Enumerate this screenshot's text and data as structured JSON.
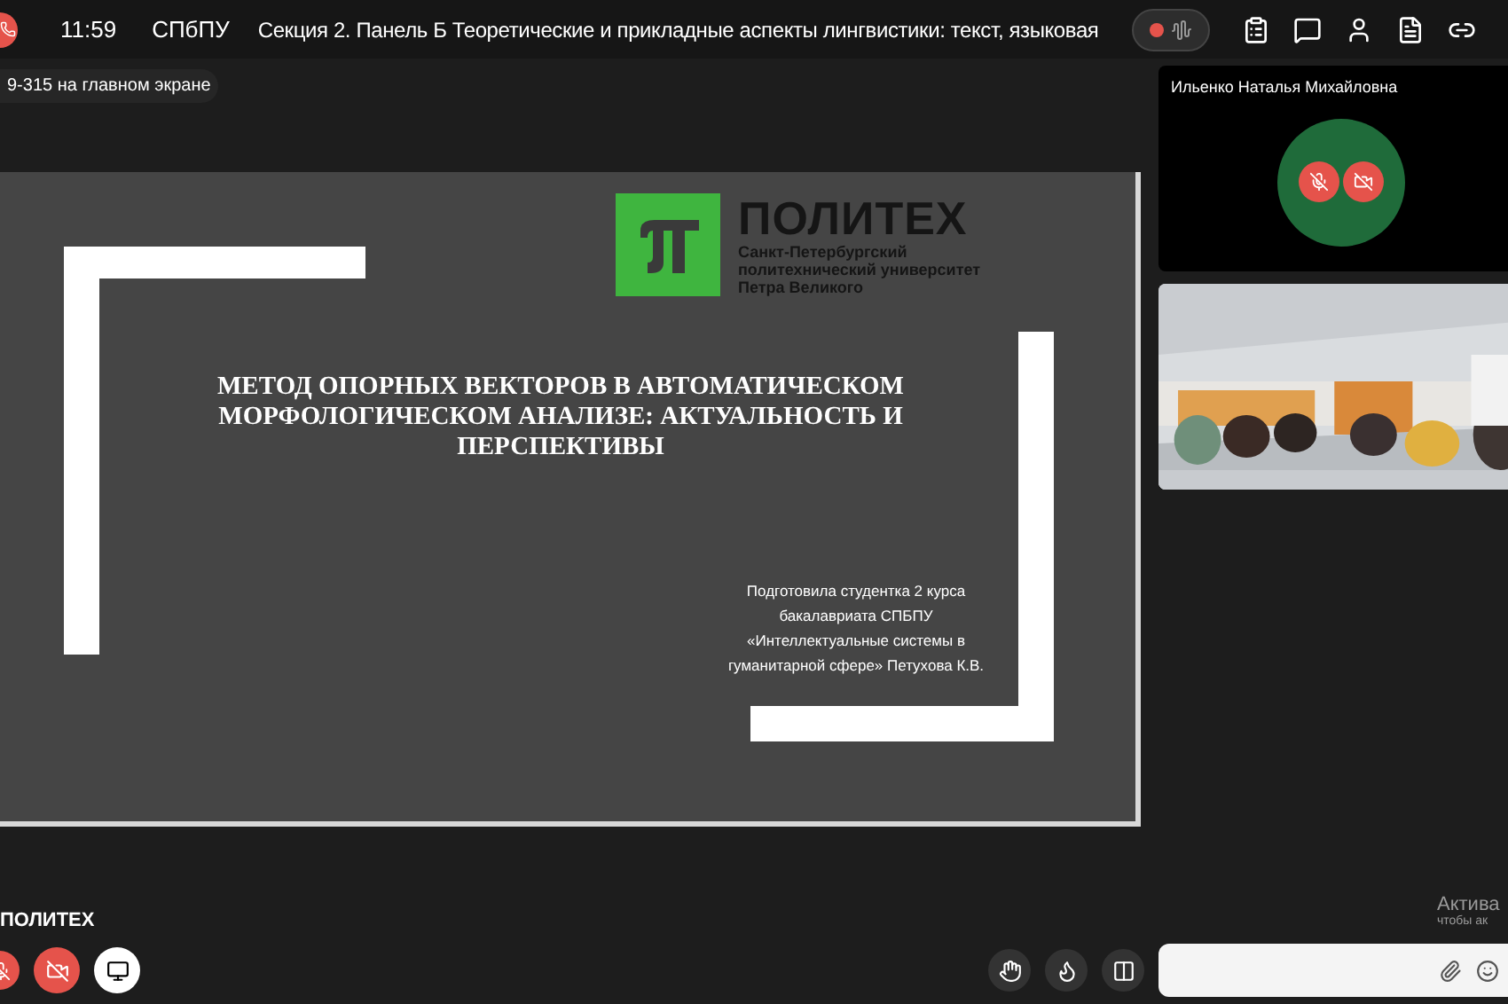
{
  "top_bar": {
    "time": "11:59",
    "org": "СПбПУ",
    "title": "Секция 2. Панель Б Теоретические и прикладные аспекты лингвистики: текст, языковая",
    "recording": true
  },
  "screen_chip": "9-315 на главном экране",
  "slide": {
    "logo_title": "ПОЛИТЕХ",
    "logo_lines": [
      "Санкт-Петербургский",
      "политехнический университет",
      "Петра Великого"
    ],
    "title_lines": [
      "МЕТОД ОПОРНЫХ ВЕКТОРОВ В АВТОМАТИЧЕСКОМ",
      "МОРФОЛОГИЧЕСКОМ АНАЛИЗЕ: АКТУАЛЬНОСТЬ И",
      "ПЕРСПЕКТИВЫ"
    ],
    "author_lines": [
      "Подготовила студентка 2 курса",
      "бакалавриата СПБПУ",
      "«Интеллектуальные системы в",
      "гуманитарной сфере» Петухова К.В."
    ]
  },
  "participants": [
    {
      "kind": "avatar",
      "name": "Ильенко Наталья Михайловна",
      "mic_muted": true,
      "camera_off": true
    },
    {
      "kind": "video"
    }
  ],
  "bottom": {
    "room_name": "ПОЛИТЕХ",
    "mic_muted": true,
    "camera_off": true
  },
  "os_notice": [
    "Актива",
    "чтобы ак"
  ]
}
